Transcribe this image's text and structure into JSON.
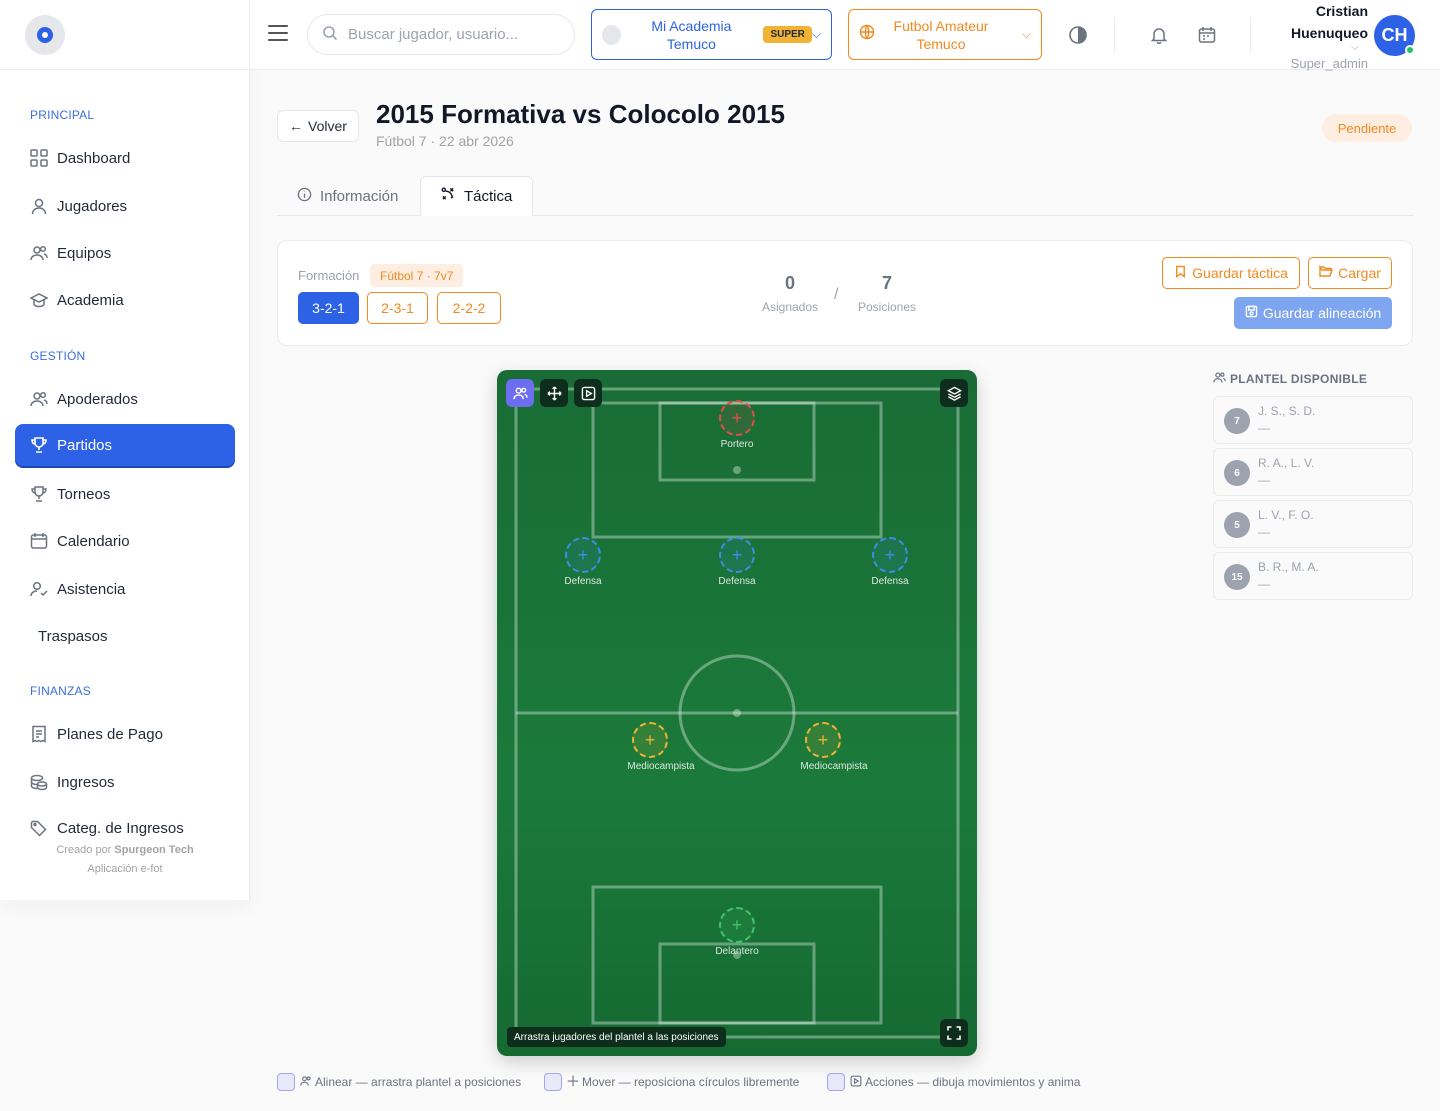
{
  "sidebar": {
    "sections": {
      "principal": "PRINCIPAL",
      "gestion": "GESTIÓN",
      "finanzas": "FINANZAS"
    },
    "items": [
      {
        "label": "Dashboard",
        "icon": "grid-icon"
      },
      {
        "label": "Jugadores",
        "icon": "user-icon"
      },
      {
        "label": "Equipos",
        "icon": "users-icon"
      },
      {
        "label": "Academia",
        "icon": "graduation-cap-icon"
      },
      {
        "label": "Apoderados",
        "icon": "users-icon"
      },
      {
        "label": "Partidos",
        "icon": "trophy-icon",
        "active": true
      },
      {
        "label": "Torneos",
        "icon": "trophy-icon"
      },
      {
        "label": "Calendario",
        "icon": "calendar-icon"
      },
      {
        "label": "Asistencia",
        "icon": "user-check-icon"
      },
      {
        "label": "Traspasos",
        "icon": ""
      },
      {
        "label": "Planes de Pago",
        "icon": "receipt-icon"
      },
      {
        "label": "Ingresos",
        "icon": "coins-icon"
      },
      {
        "label": "Categ. de Ingresos",
        "icon": "tag-icon"
      }
    ],
    "credits": {
      "created_by": "Creado por",
      "company": "Spurgeon Tech",
      "app": "Aplicación e-fot"
    }
  },
  "topbar": {
    "search_placeholder": "Buscar jugador, usuario...",
    "academy": {
      "name": "Mi Academia Temuco",
      "badge": "SUPER"
    },
    "league": {
      "name": "Futbol Amateur Temuco"
    },
    "user": {
      "name": "Cristian Huenuqueo",
      "role": "Super_admin",
      "initials": "CH"
    }
  },
  "header": {
    "back_label": "Volver",
    "title": "2015 Formativa vs Colocolo 2015",
    "subtitle": "Fútbol 7 · 22 abr 2026",
    "status": "Pendiente"
  },
  "tabs": [
    {
      "label": "Información",
      "active": false
    },
    {
      "label": "Táctica",
      "active": true
    }
  ],
  "formation": {
    "label": "Formación",
    "mode": "Fútbol 7 · 7v7",
    "options": [
      {
        "label": "3-2-1",
        "active": true
      },
      {
        "label": "2-3-1",
        "active": false
      },
      {
        "label": "2-2-2",
        "active": false
      }
    ],
    "assigned": {
      "value": "0",
      "label": "Asignados"
    },
    "separator": "/",
    "positions": {
      "value": "7",
      "label": "Posiciones"
    },
    "save_tactic": "Guardar táctica",
    "load": "Cargar",
    "save_lineup": "Guardar alineación"
  },
  "pitch": {
    "positions": [
      {
        "role": "gk",
        "label": "Portero"
      },
      {
        "role": "def",
        "label": "Defensa"
      },
      {
        "role": "def",
        "label": "Defensa"
      },
      {
        "role": "def",
        "label": "Defensa"
      },
      {
        "role": "mid",
        "label": "Mediocampista"
      },
      {
        "role": "mid",
        "label": "Mediocampista"
      },
      {
        "role": "fwd",
        "label": "Delantero"
      }
    ],
    "hint": "Arrastra jugadores del plantel a las posiciones"
  },
  "roster": {
    "title": "PLANTEL DISPONIBLE",
    "players": [
      {
        "number": "7",
        "name": "J. S., S. D.",
        "position": "—"
      },
      {
        "number": "6",
        "name": "R. A., L. V.",
        "position": "—"
      },
      {
        "number": "5",
        "name": "L. V., F. O.",
        "position": "—"
      },
      {
        "number": "15",
        "name": "B. R., M. A.",
        "position": "—"
      }
    ]
  },
  "legend": [
    {
      "label": "Alinear — arrastra plantel a posiciones",
      "icon": "users-icon"
    },
    {
      "label": "Mover — reposiciona círculos libremente",
      "icon": "move-icon"
    },
    {
      "label": "Acciones — dibuja movimientos y anima",
      "icon": "play-box-icon"
    }
  ],
  "colors": {
    "primary": "#2d62e6",
    "accent": "#f08a1e",
    "pitch": "#1b7a3b",
    "goalkeeper": "#e0504a",
    "defender": "#3b8fe6",
    "midfielder": "#f2b233",
    "forward": "#43c46a"
  }
}
